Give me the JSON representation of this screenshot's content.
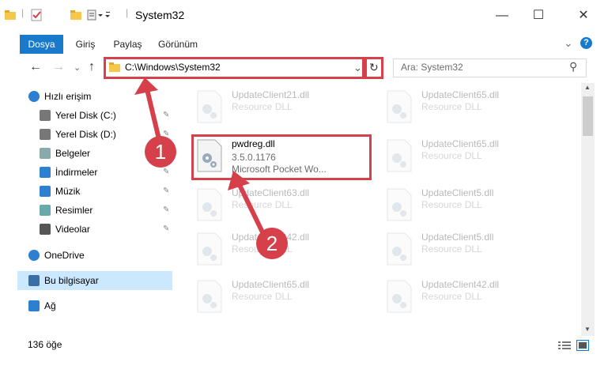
{
  "window": {
    "title": "System32",
    "min_glyph": "—",
    "max_glyph": "☐",
    "close_glyph": "✕"
  },
  "ribbon": {
    "tabs": [
      "Dosya",
      "Giriş",
      "Paylaş",
      "Görünüm"
    ],
    "collapse_glyph": "⌄",
    "help_glyph": "?"
  },
  "address": {
    "path": "C:\\Windows\\System32",
    "search_placeholder": "Ara: System32",
    "back_glyph": "←",
    "forward_glyph": "→",
    "recent_glyph": "⌄",
    "up_glyph": "↑",
    "dropdown_glyph": "⌄",
    "refresh_glyph": "↻",
    "search_glyph": "⚲"
  },
  "nav": {
    "items": [
      {
        "label": "Hızlı erişim",
        "icon": "star-icon",
        "pinned": false
      },
      {
        "label": "Yerel Disk (C:)",
        "icon": "drive-icon",
        "pinned": true
      },
      {
        "label": "Yerel Disk (D:)",
        "icon": "drive-icon",
        "pinned": true
      },
      {
        "label": "Belgeler",
        "icon": "documents-icon",
        "pinned": true
      },
      {
        "label": "İndirmeler",
        "icon": "download-icon",
        "pinned": true
      },
      {
        "label": "Müzik",
        "icon": "music-icon",
        "pinned": true
      },
      {
        "label": "Resimler",
        "icon": "pictures-icon",
        "pinned": true
      },
      {
        "label": "Videolar",
        "icon": "videos-icon",
        "pinned": true
      },
      {
        "label": "OneDrive",
        "icon": "cloud-icon",
        "pinned": false
      },
      {
        "label": "Bu bilgisayar",
        "icon": "computer-icon",
        "pinned": false
      },
      {
        "label": "Ağ",
        "icon": "network-icon",
        "pinned": false
      }
    ],
    "pin_glyph": "📌"
  },
  "files": {
    "highlight": {
      "name": "pwdreg.dll",
      "version": "3.5.0.1176",
      "description": "Microsoft Pocket Wo..."
    },
    "col1": [
      {
        "name": "UpdateClient21.dll",
        "type": "Resource DLL"
      },
      {
        "name": "UpdateClient63.dll",
        "type": "Resource DLL"
      },
      {
        "name": "UpdateClient42.dll",
        "type": "Resource DLL"
      },
      {
        "name": "UpdateClient65.dll",
        "type": "Resource DLL"
      }
    ],
    "col2": [
      {
        "name": "UpdateClient65.dll",
        "type": "Resource DLL"
      },
      {
        "name": "UpdateClient65.dll",
        "type": "Resource DLL"
      },
      {
        "name": "UpdateClient5.dll",
        "type": "Resource DLL"
      },
      {
        "name": "UpdateClient5.dll",
        "type": "Resource DLL"
      },
      {
        "name": "UpdateClient42.dll",
        "type": "Resource DLL"
      }
    ]
  },
  "status": {
    "count": "136 öğe"
  },
  "annotations": {
    "step1": "1",
    "step2": "2",
    "color": "#d6404a"
  }
}
